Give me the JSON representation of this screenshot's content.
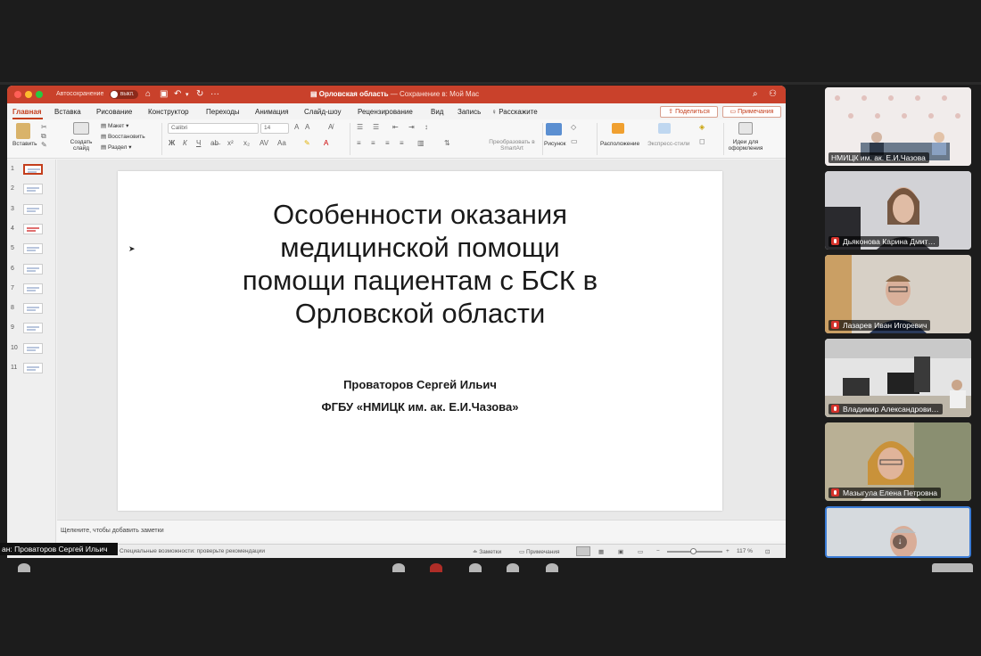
{
  "window": {
    "autosave_label": "Автосохранение",
    "autosave_state": "ВЫКЛ.",
    "document_name": "Орловская область",
    "save_status": "— Сохранение в: Мой Mac",
    "accent_color": "#c9412b"
  },
  "menu": {
    "tabs": [
      "Главная",
      "Вставка",
      "Рисование",
      "Конструктор",
      "Переходы",
      "Анимация",
      "Слайд-шоу",
      "Рецензирование",
      "Вид",
      "Запись"
    ],
    "tell_me": "Расскажите",
    "share": "Поделиться",
    "comments": "Примечания"
  },
  "ribbon": {
    "paste": "Вставить",
    "new_slide": "Создать слайд",
    "layout": "Макет",
    "reset": "Восстановить",
    "section": "Раздел",
    "font_name": "Calibri",
    "font_size": "14",
    "convert_smartart": "Преобразовать в SmartArt",
    "picture": "Рисунок",
    "arrange": "Расположение",
    "quick_styles": "Экспресс-стили",
    "design_ideas": "Идеи для оформления"
  },
  "thumbnails": [
    "1",
    "2",
    "3",
    "4",
    "5",
    "6",
    "7",
    "8",
    "9",
    "10",
    "11"
  ],
  "slide": {
    "title_lines": [
      "Особенности оказания",
      "медицинской помощи",
      "помощи пациентам с БСК в",
      "Орловской области"
    ],
    "author": "Проваторов Сергей Ильич",
    "organization": "ФГБУ «НМИЦК им. ак. Е.И.Чазова»"
  },
  "notes": {
    "placeholder": "Щелкните, чтобы добавить заметки"
  },
  "status": {
    "accessibility": "Специальные возможности: проверьте рекомендации",
    "notes": "Заметки",
    "comments": "Примечания",
    "zoom": "117 %"
  },
  "speaker_label": "ан: Проваторов Сергей Ильич",
  "participants": [
    {
      "name": "НМИЦК им. ак. Е.И.Чазова",
      "muted": false
    },
    {
      "name": "Дьяконова Карина Дмит…",
      "muted": true
    },
    {
      "name": "Лазарев Иван Игоревич",
      "muted": true
    },
    {
      "name": "Владимир Александрови…",
      "muted": true
    },
    {
      "name": "Мазыгула Елена Петровна",
      "muted": true
    }
  ]
}
